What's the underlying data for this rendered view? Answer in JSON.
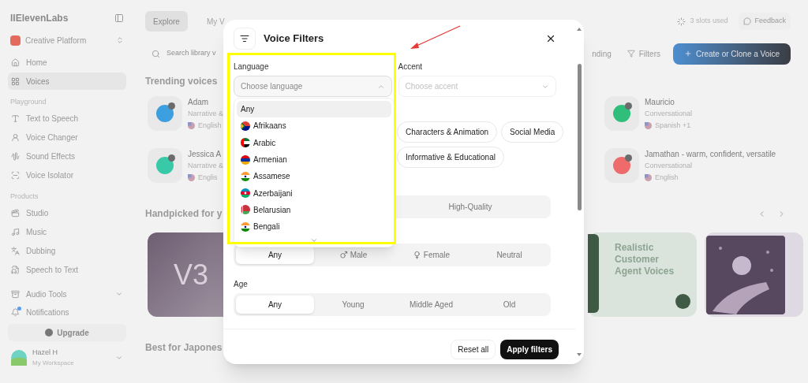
{
  "sidebar": {
    "logo": "IIElevenLabs",
    "workspace": "Creative Platform",
    "items": [
      {
        "label": "Home",
        "selected": false
      },
      {
        "label": "Voices",
        "selected": true
      }
    ],
    "sections": [
      {
        "title": "Playground",
        "items": [
          {
            "label": "Text to Speech"
          },
          {
            "label": "Voice Changer"
          },
          {
            "label": "Sound Effects"
          },
          {
            "label": "Voice Isolator"
          }
        ]
      },
      {
        "title": "Products",
        "items": [
          {
            "label": "Studio"
          },
          {
            "label": "Music"
          },
          {
            "label": "Dubbing"
          },
          {
            "label": "Speech to Text"
          }
        ]
      }
    ],
    "tools": [
      {
        "label": "Audio Tools",
        "kind": "expandable"
      },
      {
        "label": "Notifications",
        "kind": "notification"
      }
    ],
    "upgrade": "Upgrade",
    "user": {
      "name": "Hazel H",
      "workspace": "My Workspace"
    }
  },
  "top_bar": {
    "tabs": [
      {
        "label": "Explore",
        "selected": true
      },
      {
        "label": "My V",
        "selected": false
      }
    ],
    "slots": "3 slots used",
    "feedback": "Feedback"
  },
  "toolbar": {
    "search_placeholder": "Search library v",
    "trending": "nding",
    "filters": "Filters",
    "create": "Create or Clone a Voice"
  },
  "trending": {
    "title": "Trending voices",
    "left": [
      {
        "name": "Adam",
        "category": "Narrative &",
        "language": "English",
        "color": "#3d9ee0"
      },
      {
        "name": "Jessica A",
        "category": "Narrative &",
        "language": "Englis",
        "color": "#38c9a9"
      }
    ],
    "right": [
      {
        "name": "Mauricio",
        "category": "Conversational",
        "language": "Spanish +1",
        "color": "#2fbf7a"
      },
      {
        "name": "Jamathan - warm, confident, versatile",
        "category": "Conversational",
        "language": "English",
        "color": "#ef6b6b"
      }
    ]
  },
  "handpicked": {
    "title": "Handpicked for y",
    "cards": [
      {
        "kind": "v3",
        "text": "V3"
      },
      {
        "kind": "promo",
        "text": "Realistic Customer Agent Voices"
      },
      {
        "kind": "picture"
      }
    ]
  },
  "best_for": {
    "title": "Best for Japones"
  },
  "modal": {
    "title": "Voice Filters",
    "language": {
      "label": "Language",
      "placeholder": "Choose language",
      "expanded": true,
      "options": [
        {
          "label": "Any",
          "kind": "any",
          "selected": true
        },
        {
          "label": "Afrikaans",
          "kind": "language",
          "selected": false
        },
        {
          "label": "Arabic",
          "kind": "language",
          "selected": false
        },
        {
          "label": "Armenian",
          "kind": "language",
          "selected": false
        },
        {
          "label": "Assamese",
          "kind": "language",
          "selected": false
        },
        {
          "label": "Azerbaijani",
          "kind": "language",
          "selected": false
        },
        {
          "label": "Belarusian",
          "kind": "language",
          "selected": false
        },
        {
          "label": "Bengali",
          "kind": "language",
          "selected": false
        }
      ]
    },
    "accent": {
      "label": "Accent",
      "placeholder": "Choose accent",
      "expanded": false
    },
    "use_cases": [
      [
        {
          "label": "Characters & Animation"
        },
        {
          "label": "Social Media"
        }
      ],
      [
        {
          "label": "Informative & Educational"
        }
      ]
    ],
    "quality": [
      {
        "label": "High-Quality",
        "selected": false
      }
    ],
    "gender": [
      {
        "label": "Any",
        "kind": "plain",
        "selected": true
      },
      {
        "label": "Male",
        "kind": "male",
        "selected": false
      },
      {
        "label": "Female",
        "kind": "female",
        "selected": false
      },
      {
        "label": "Neutral",
        "kind": "plain",
        "selected": false
      }
    ],
    "age": {
      "label": "Age",
      "options": [
        {
          "label": "Any",
          "selected": true
        },
        {
          "label": "Young",
          "selected": false
        },
        {
          "label": "Middle Aged",
          "selected": false
        },
        {
          "label": "Old",
          "selected": false
        }
      ]
    },
    "reset": "Reset all",
    "apply": "Apply filters"
  }
}
